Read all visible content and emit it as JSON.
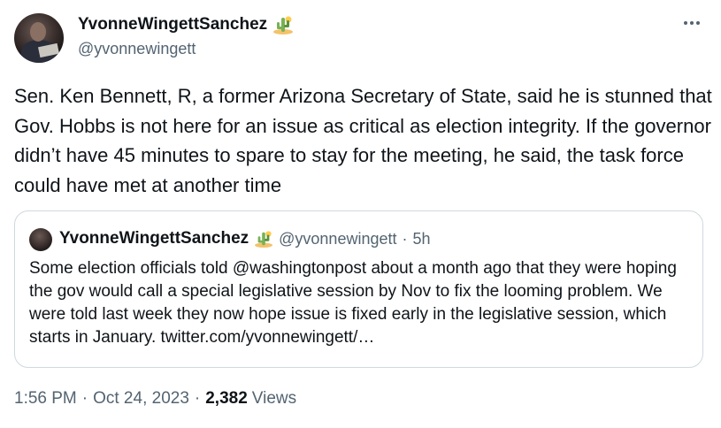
{
  "author": {
    "display_name": "YvonneWingettSanchez",
    "handle": "@yvonnewingett",
    "badge_emoji": "cactus-desert-emoji"
  },
  "tweet_text": "Sen. Ken Bennett, R, a former Arizona Secretary of State, said he is stunned that Gov. Hobbs is not here for an issue as critical as election integrity. If the governor didn’t have 45 minutes to spare to stay for the meeting, he said, the task force could have met at another time",
  "quoted": {
    "display_name": "YvonneWingettSanchez",
    "handle": "@yvonnewingett",
    "dot": "·",
    "time": "5h",
    "text": "Some election officials told @washingtonpost about a month ago that they were hoping the gov would call a special legislative session by Nov to fix the looming problem. We were told last week they now hope issue is fixed early in the legislative session, which starts in January. twitter.com/yvonnewingett/…"
  },
  "meta": {
    "time": "1:56 PM",
    "dot1": "·",
    "date": "Oct 24, 2023",
    "dot2": "·",
    "views_count": "2,382",
    "views_label": "Views"
  },
  "icons": {
    "more": "more-options-icon",
    "badge": "cactus-emoji"
  },
  "colors": {
    "text_primary": "#0f1419",
    "text_secondary": "#536471",
    "border": "#cfd9de"
  }
}
